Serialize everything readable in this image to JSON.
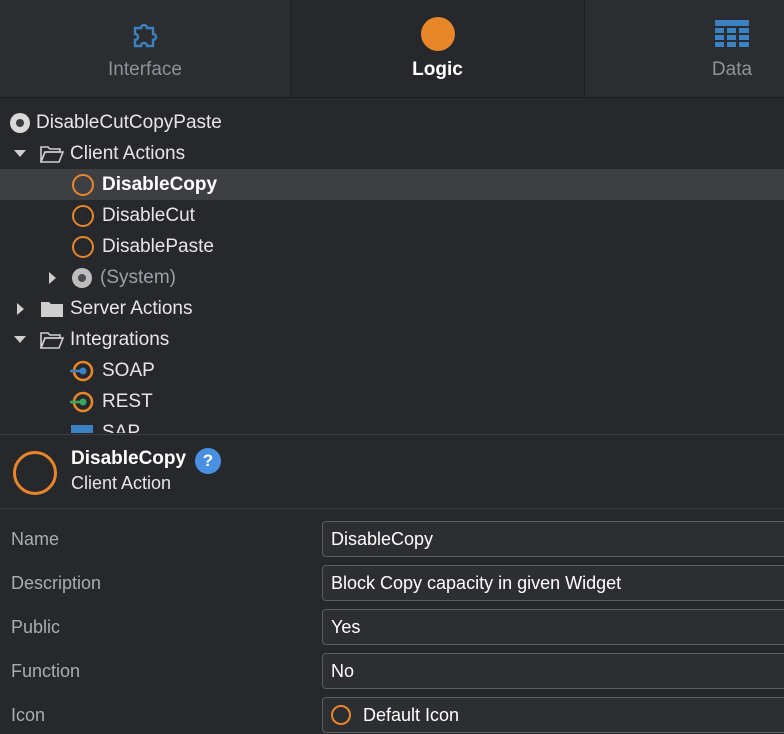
{
  "tabs": [
    {
      "label": "Interface",
      "icon": "puzzle-icon",
      "active": false
    },
    {
      "label": "Logic",
      "icon": "logic-circle-icon",
      "active": true
    },
    {
      "label": "Data",
      "icon": "grid-icon",
      "active": false
    }
  ],
  "tree": {
    "module": "DisableCutCopyPaste",
    "client_actions_folder": "Client Actions",
    "client_actions": [
      "DisableCopy",
      "DisableCut",
      "DisablePaste"
    ],
    "system": "(System)",
    "server_actions_folder": "Server Actions",
    "integrations_folder": "Integrations",
    "integrations": [
      "SOAP",
      "REST",
      "SAP"
    ]
  },
  "detail": {
    "title": "DisableCopy",
    "help": "?",
    "subtitle": "Client Action"
  },
  "properties": {
    "name_label": "Name",
    "name_value": "DisableCopy",
    "description_label": "Description",
    "description_value": "Block Copy capacity in given Widget",
    "public_label": "Public",
    "public_value": "Yes",
    "function_label": "Function",
    "function_value": "No",
    "icon_label": "Icon",
    "icon_value": "Default Icon"
  },
  "colors": {
    "accent": "#e8862a",
    "tab_icon_blue": "#3b82c4",
    "help_blue": "#4a90e2"
  }
}
